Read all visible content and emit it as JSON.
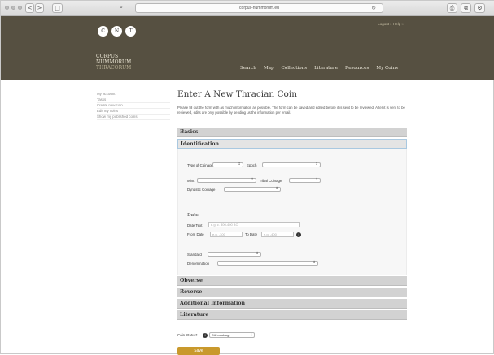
{
  "browser": {
    "url": "corpus-nummorum.eu",
    "nav_back": "<",
    "nav_forward": ">",
    "sidebar_toggle": "□",
    "share_icon": "⎙",
    "tabs_icon": "⧉",
    "extensions_icon": "⚙"
  },
  "header": {
    "logo_letters": [
      "C",
      "N",
      "T"
    ],
    "logo_lines": [
      "CORPUS",
      "NUMMORUM",
      "THRACORUM"
    ],
    "top_links": "Logout »   Help »",
    "nav": [
      "Search",
      "Map",
      "Collections",
      "Literature",
      "Resources",
      "My Coins"
    ]
  },
  "sidebar": {
    "items": [
      "My account",
      "Tasks",
      "Create new coin",
      "Edit my coins",
      "Show my published coins"
    ]
  },
  "main": {
    "title": "Enter A New Thracian Coin",
    "intro": "Please fill out the form with as much information as possible. The form can be saved and edited before it is sent to be reviewed. After it is sent to be reviewed, edits are only possible by sending us the information per email.",
    "sections": {
      "basics": "Basics",
      "identification": "Identification",
      "obverse": "Obverse",
      "reverse": "Reverse",
      "additional": "Additional Information",
      "literature": "Literature"
    },
    "identification": {
      "type_of_coinage": "Type of Coinage",
      "epoch": "Epoch",
      "mint": "Mint",
      "tribal_coinage": "Tribal Coinage",
      "dynastic_coinage": "Dynastic Coinage",
      "date_heading": "Date",
      "date_text": "Date Text",
      "date_text_placeholder": "e.g. c. 300-400 BC",
      "from_date": "From Date",
      "from_date_placeholder": "e.g. -300",
      "to_date": "To Date",
      "to_date_placeholder": "e.g. -400",
      "info_glyph": "i",
      "standard": "Standard",
      "denomination": "Denomination"
    },
    "status": {
      "label": "Coin Status*",
      "info_glyph": "i",
      "value": "Still working"
    },
    "save_label": "Save"
  }
}
